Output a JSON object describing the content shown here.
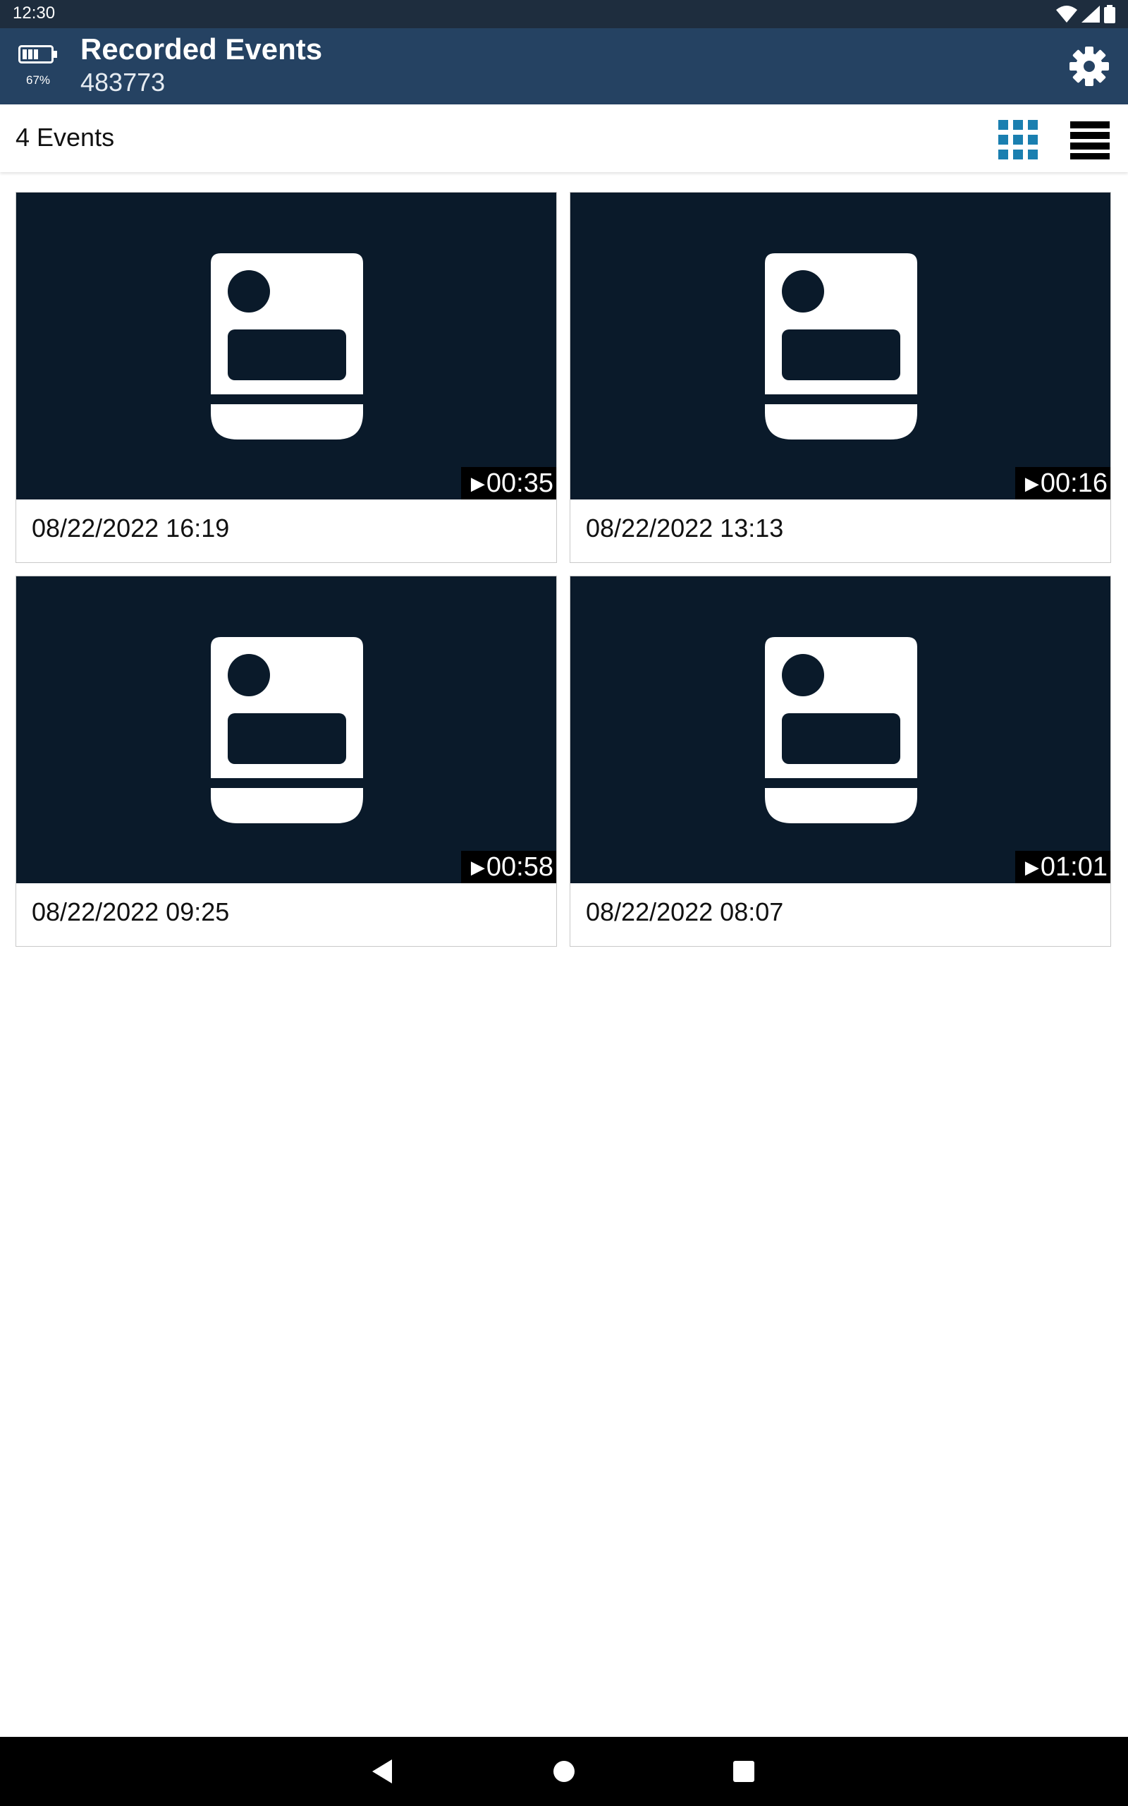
{
  "status_bar": {
    "time": "12:30",
    "icons": [
      "wifi-icon",
      "signal-icon",
      "battery-status-icon"
    ]
  },
  "app_bar": {
    "battery_percent": "67%",
    "title": "Recorded Events",
    "subtitle": "483773",
    "settings_icon": "gear-icon"
  },
  "toolbar": {
    "count_label": "4 Events",
    "grid_icon": "grid-view-icon",
    "list_icon": "list-view-icon",
    "grid_color": "#1a7fb0"
  },
  "events": [
    {
      "date": "08/22/2022 16:19",
      "duration": "00:35"
    },
    {
      "date": "08/22/2022 13:13",
      "duration": "00:16"
    },
    {
      "date": "08/22/2022 09:25",
      "duration": "00:58"
    },
    {
      "date": "08/22/2022 08:07",
      "duration": "01:01"
    }
  ],
  "nav_bar": {
    "buttons": [
      "back-icon",
      "home-icon",
      "recents-icon"
    ]
  }
}
